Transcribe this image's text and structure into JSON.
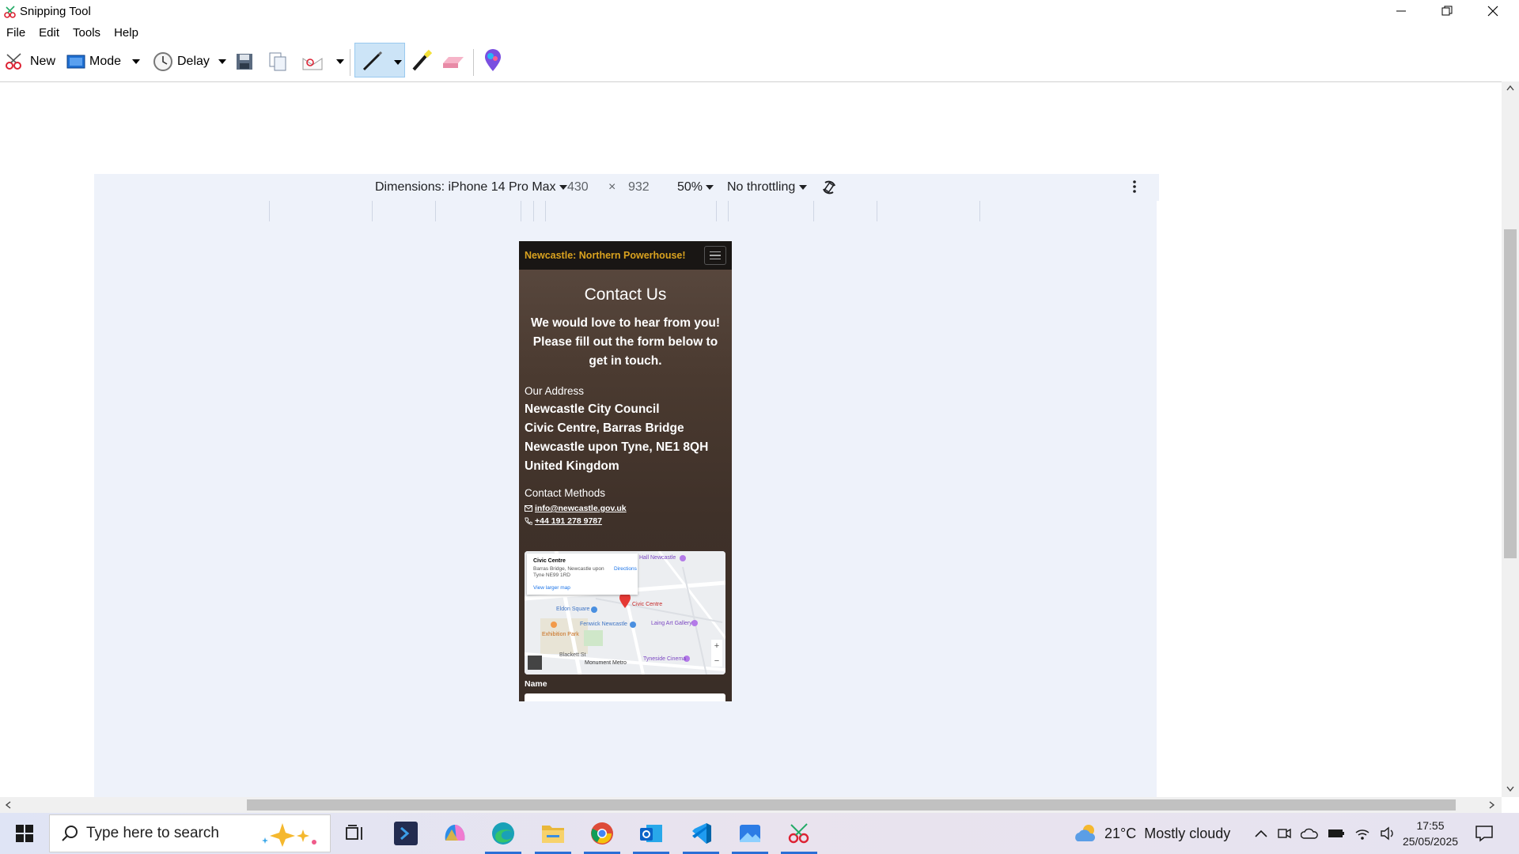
{
  "window": {
    "title": "Snipping Tool",
    "icon": "snipping-tool-icon"
  },
  "menu": [
    "File",
    "Edit",
    "Tools",
    "Help"
  ],
  "toolbar": {
    "new_label": "New",
    "mode_label": "Mode",
    "delay_label": "Delay"
  },
  "devtools": {
    "dimensions_label": "Dimensions: iPhone 14 Pro Max",
    "width": "430",
    "times": "×",
    "height": "932",
    "zoom": "50%",
    "throttling": "No throttling"
  },
  "page": {
    "brand": "Newcastle: Northern Powerhouse!",
    "title": "Contact Us",
    "intro": "We would love to hear from you! Please fill out the form below to get in touch.",
    "address_label": "Our Address",
    "address_lines": [
      "Newcastle City Council",
      "Civic Centre, Barras Bridge",
      "Newcastle upon Tyne, NE1 8QH",
      "United Kingdom"
    ],
    "methods_label": "Contact Methods",
    "email": "info@newcastle.gov.uk",
    "phone": "+44 191 278 9787",
    "map": {
      "place": "Civic Centre",
      "place_address": "Barras Bridge, Newcastle upon Tyne NE99 1RD",
      "directions": "Directions",
      "view_larger": "View larger map",
      "marker_label": "Civic Centre",
      "poi": [
        "Laing Art Gallery",
        "Tyneside Cinema",
        "Eldon Square",
        "Fenwick Newcastle",
        "Exhibition Park",
        "Monument Metro",
        "Blackett St",
        "Hall Newcastle"
      ]
    },
    "name_label": "Name"
  },
  "taskbar": {
    "search_placeholder": "Type here to search",
    "weather_temp": "21°C",
    "weather_desc": "Mostly cloudy",
    "time": "17:55",
    "date": "25/05/2025"
  },
  "colors": {
    "brand": "#d9a21f",
    "pen_active": "#cce4f7",
    "taskbar_underline": "#2b6fd6"
  }
}
